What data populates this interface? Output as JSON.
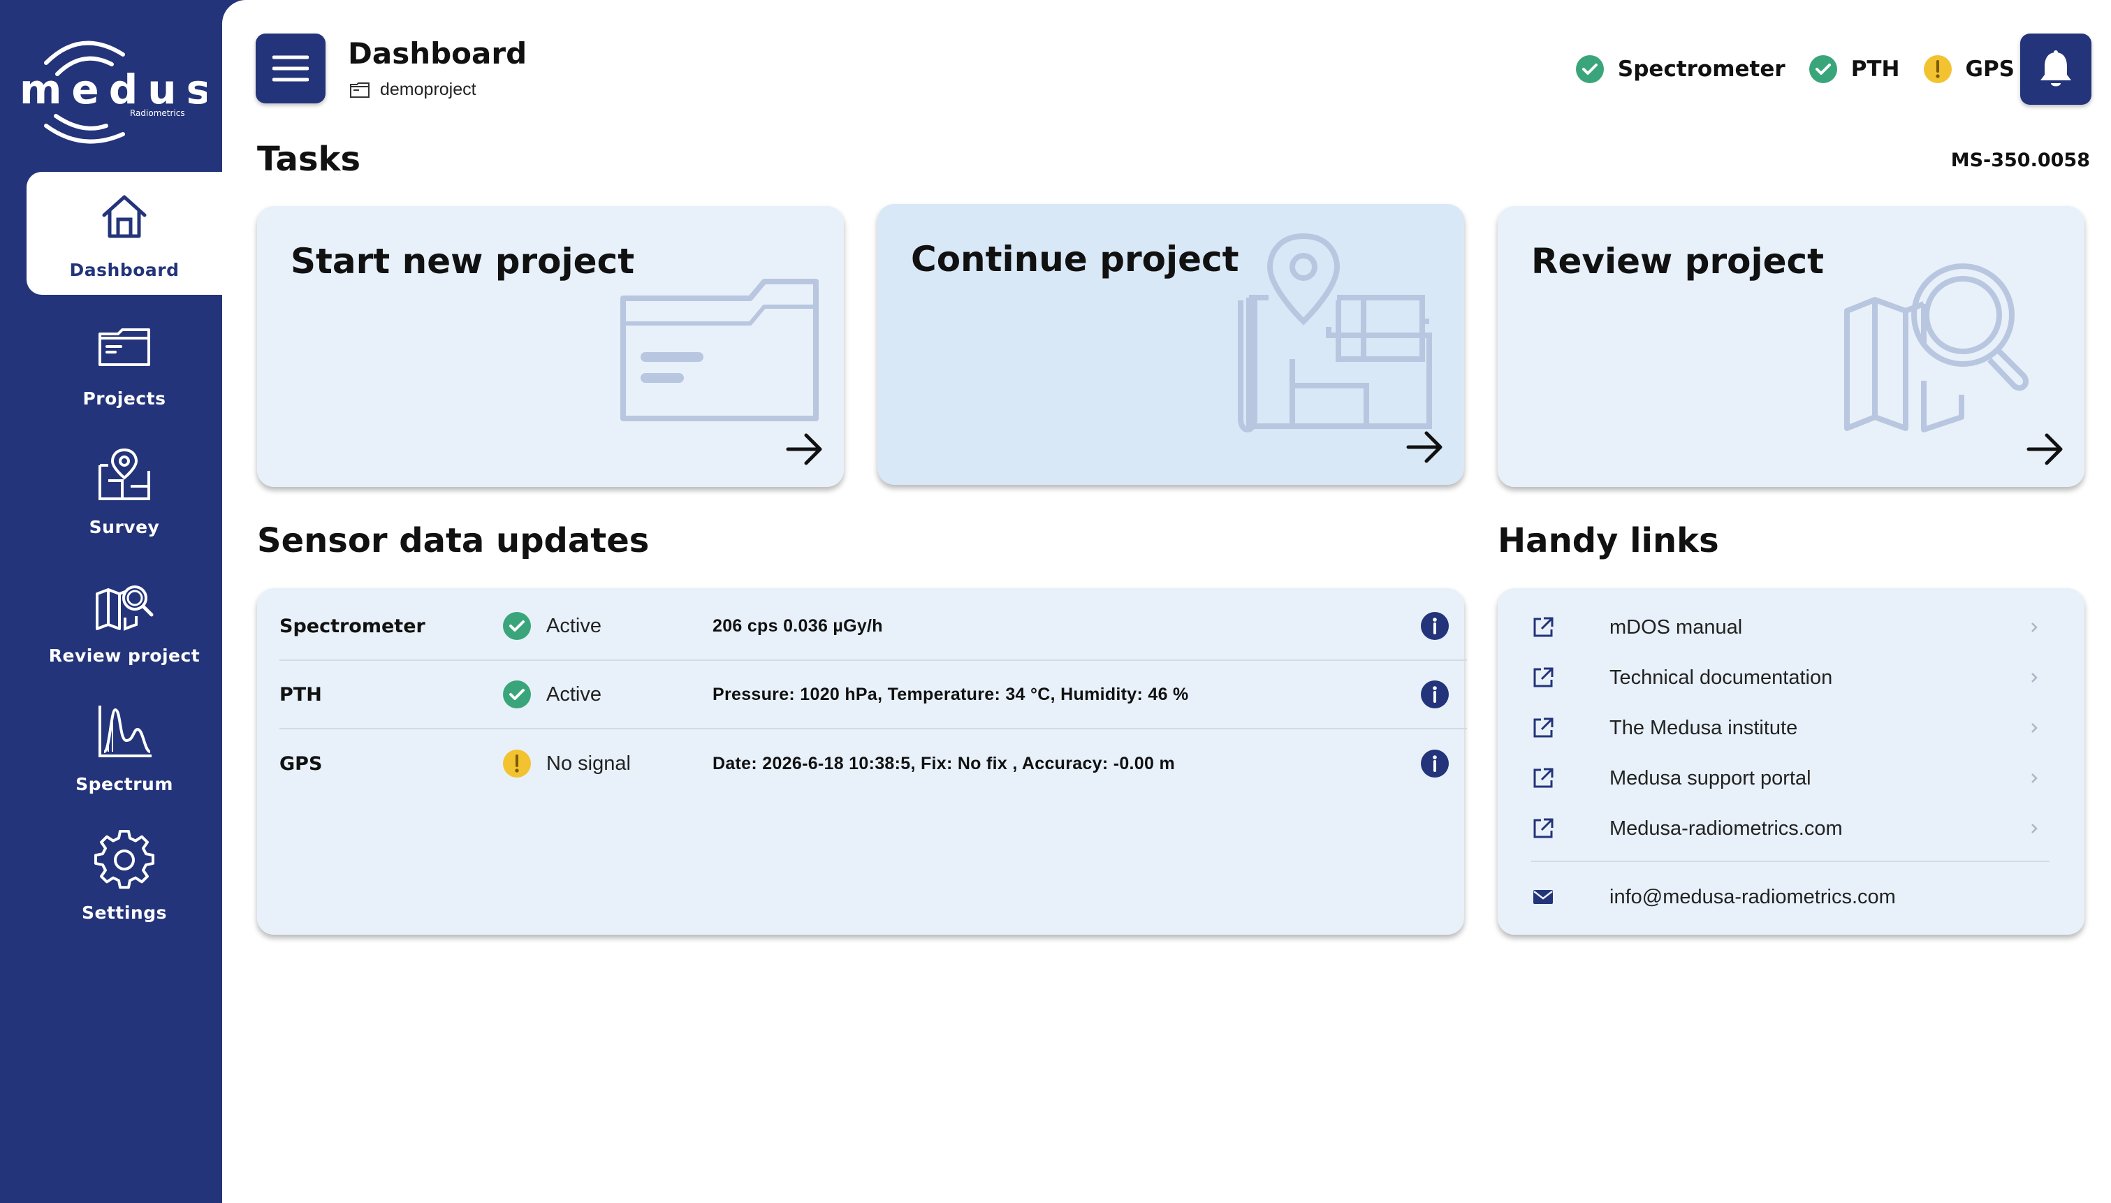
{
  "brand": {
    "name": "medusa",
    "sub": "Radiometrics"
  },
  "sidebar": {
    "items": [
      {
        "label": "Dashboard",
        "icon": "home-icon",
        "active": true
      },
      {
        "label": "Projects",
        "icon": "folder-icon"
      },
      {
        "label": "Survey",
        "icon": "map-pin-icon"
      },
      {
        "label": "Review project",
        "icon": "map-search-icon"
      },
      {
        "label": "Spectrum",
        "icon": "spectrum-icon"
      },
      {
        "label": "Settings",
        "icon": "gear-icon"
      }
    ]
  },
  "header": {
    "title": "Dashboard",
    "project": "demoproject",
    "status": [
      {
        "label": "Spectrometer",
        "state": "ok"
      },
      {
        "label": "PTH",
        "state": "ok"
      },
      {
        "label": "GPS",
        "state": "warning"
      }
    ]
  },
  "tasks": {
    "title": "Tasks",
    "serial": "MS-350.0058",
    "cards": [
      {
        "label": "Start new project"
      },
      {
        "label": "Continue project"
      },
      {
        "label": "Review project"
      }
    ]
  },
  "sensors": {
    "title": "Sensor data updates",
    "rows": [
      {
        "name": "Spectrometer",
        "status": "Active",
        "state": "ok",
        "value": "206 cps 0.036 µGy/h"
      },
      {
        "name": "PTH",
        "status": "Active",
        "state": "ok",
        "value": "Pressure: 1020 hPa, Temperature: 34 °C, Humidity: 46 %"
      },
      {
        "name": "GPS",
        "status": "No signal",
        "state": "warning",
        "value": "Date: 2026-6-18 10:38:5, Fix: No fix , Accuracy: -0.00 m"
      }
    ]
  },
  "links": {
    "title": "Handy links",
    "items": [
      {
        "label": "mDOS manual"
      },
      {
        "label": "Technical documentation"
      },
      {
        "label": "The Medusa institute"
      },
      {
        "label": "Medusa support portal"
      },
      {
        "label": "Medusa-radiometrics.com"
      }
    ],
    "email": "info@medusa-radiometrics.com"
  },
  "colors": {
    "primary": "#23347a",
    "card": "#e8f1f9",
    "ok": "#3aa57a",
    "warning": "#f2c230",
    "illustration": "#b9c6e0"
  }
}
